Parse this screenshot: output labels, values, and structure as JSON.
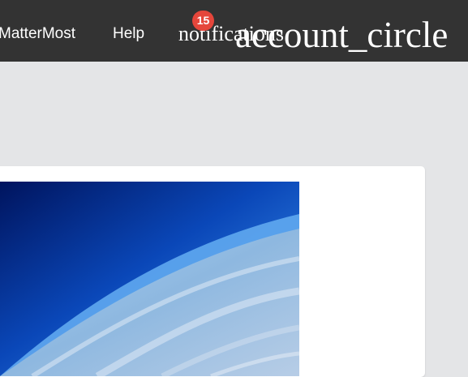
{
  "header": {
    "nav_mattermost": "MatterMost",
    "nav_help": "Help",
    "notifications_icon": "notifications",
    "notification_count": "15",
    "account_icon": "account_circle"
  },
  "colors": {
    "header_bg": "#333333",
    "page_bg": "#e4e5e7",
    "badge_bg": "#e5463b",
    "card_bg": "#ffffff"
  },
  "card": {
    "image_icon": "earth-from-stratosphere-image"
  }
}
